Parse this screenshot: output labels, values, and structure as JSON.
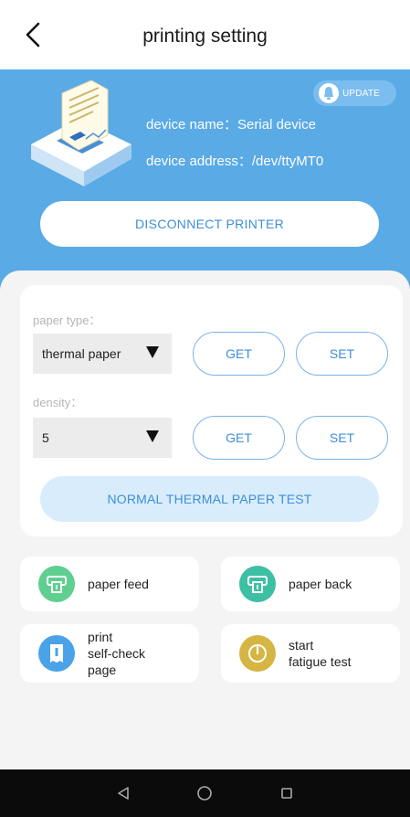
{
  "header": {
    "title": "printing setting",
    "back_icon": "chevron-left-icon"
  },
  "device": {
    "update_label": "UPDATE",
    "name_line": "device name：Serial device",
    "address_line": "device address：/dev/ttyMT0",
    "disconnect_label": "DISCONNECT PRINTER"
  },
  "settings": {
    "paper_type": {
      "label": "paper type：",
      "value": "thermal paper",
      "get_label": "GET",
      "set_label": "SET"
    },
    "density": {
      "label": "density：",
      "value": "5",
      "get_label": "GET",
      "set_label": "SET"
    },
    "test_label": "NORMAL THERMAL PAPER TEST"
  },
  "actions": [
    {
      "label": "paper feed",
      "icon": "printer-icon",
      "color": "#5fcf8f"
    },
    {
      "label": "paper back",
      "icon": "printer-icon",
      "color": "#3dbfa3"
    },
    {
      "label": "print\nself-check\npage",
      "icon": "receipt-icon",
      "color": "#4aa3e8"
    },
    {
      "label": "start\nfatigue test",
      "icon": "gauge-icon",
      "color": "#d6b543"
    }
  ],
  "nav": {
    "back_icon": "nav-back-icon",
    "home_icon": "nav-home-icon",
    "recents_icon": "nav-recents-icon"
  },
  "colors": {
    "accent": "#3d8fd8",
    "hero_bg": "#5aaae6",
    "test_bg": "#d9ecfb"
  }
}
